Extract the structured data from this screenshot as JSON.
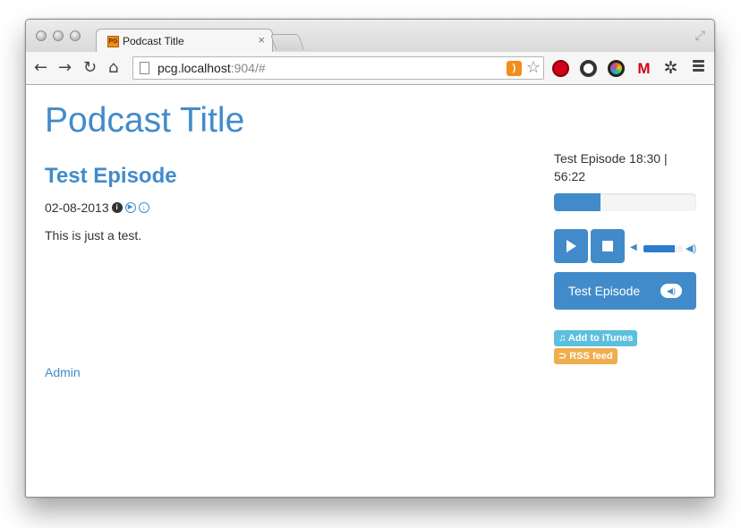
{
  "browser": {
    "tab_title": "Podcast Title",
    "tab_close": "×",
    "url_host": "pcg.localhost",
    "url_rest": ":904/#",
    "favicon_text": "PG"
  },
  "page": {
    "site_title": "Podcast Title",
    "episode": {
      "title": "Test Episode",
      "date": "02-08-2013",
      "description": "This is just a test."
    },
    "admin_link": "Admin"
  },
  "player": {
    "now_playing": "Test Episode 18:30 | 56:22",
    "progress_fraction": 0.33,
    "volume_fraction": 0.8,
    "episode_button_label": "Test Episode",
    "itunes_label": "♫ Add to iTunes",
    "rss_label": "⊃ RSS feed"
  },
  "colors": {
    "accent": "#428bca",
    "itunes_badge": "#5bc0de",
    "rss_badge": "#f0ad4e"
  }
}
